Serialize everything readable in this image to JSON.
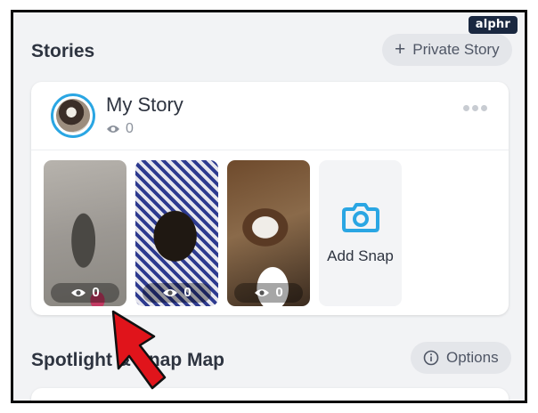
{
  "brand": {
    "logo_text": "alphr"
  },
  "stories_section": {
    "title": "Stories",
    "private_story_button": "Private Story"
  },
  "my_story": {
    "name": "My Story",
    "views": "0",
    "snaps": [
      {
        "views": "0"
      },
      {
        "views": "0"
      },
      {
        "views": "0"
      }
    ],
    "add_snap_label": "Add Snap"
  },
  "spotlight_section": {
    "title": "Spotlight & Snap Map",
    "options_button": "Options"
  },
  "icons": {
    "plus": "plus-icon",
    "eye": "eye-icon",
    "more": "more-dots-icon",
    "camera": "camera-icon",
    "info": "info-icon",
    "annotation_arrow": "red-arrow-icon"
  },
  "colors": {
    "accent_blue": "#2aa6e3",
    "annotation_red": "#e0141b",
    "background": "#f2f3f5"
  }
}
